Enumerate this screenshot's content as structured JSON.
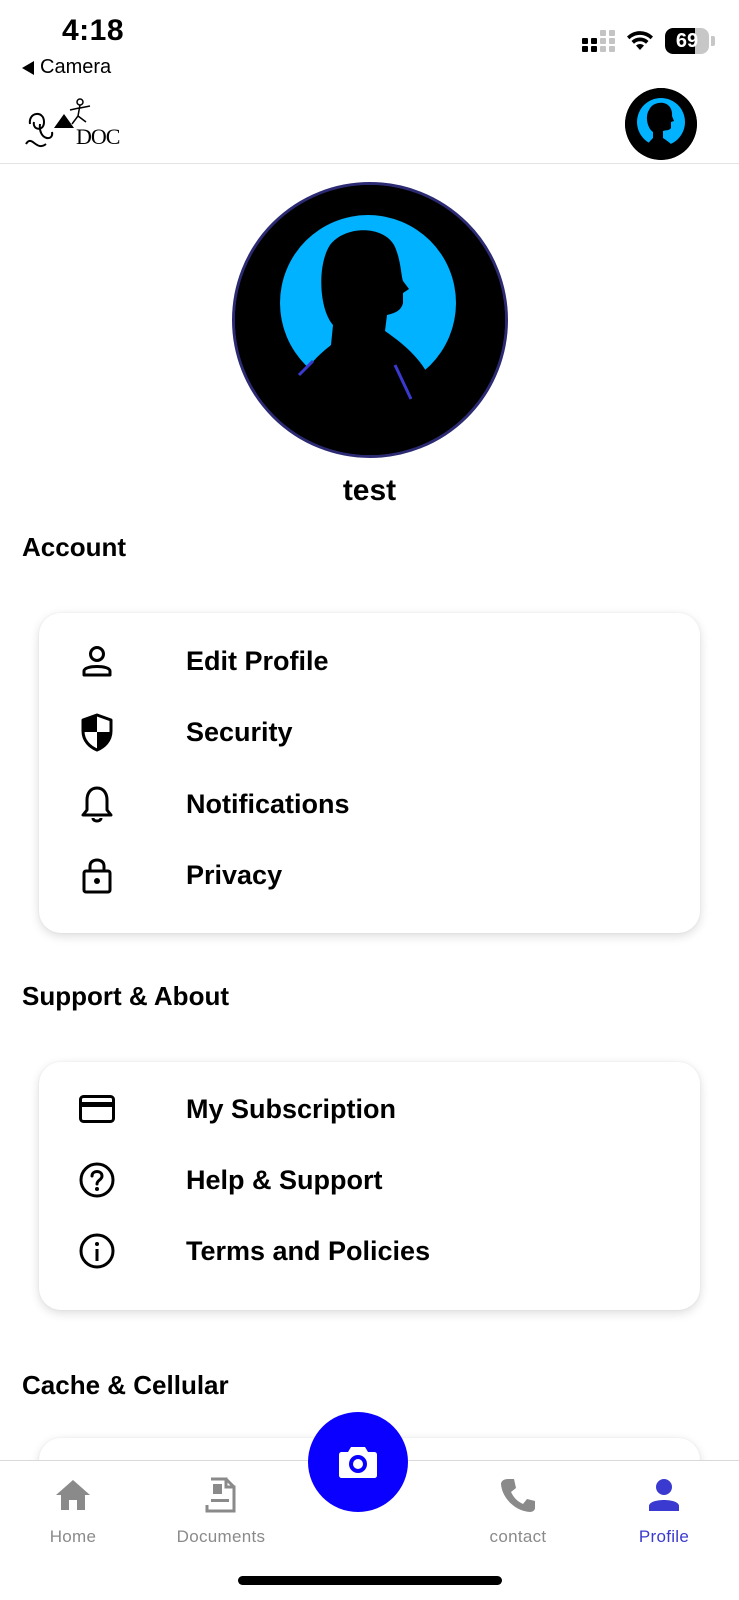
{
  "status_bar": {
    "time": "4:18",
    "back_app": "Camera",
    "battery": "69",
    "battery_level": 0.69
  },
  "header": {
    "logo_text": "DOC"
  },
  "profile": {
    "name": "test"
  },
  "sections": {
    "account": {
      "title": "Account",
      "items": [
        {
          "label": "Edit Profile",
          "icon": "person-outline-icon"
        },
        {
          "label": "Security",
          "icon": "shield-icon"
        },
        {
          "label": "Notifications",
          "icon": "bell-icon"
        },
        {
          "label": "Privacy",
          "icon": "lock-icon"
        }
      ]
    },
    "support": {
      "title": "Support & About",
      "items": [
        {
          "label": "My Subscription",
          "icon": "credit-card-icon"
        },
        {
          "label": "Help & Support",
          "icon": "help-circle-icon"
        },
        {
          "label": "Terms and Policies",
          "icon": "info-circle-icon"
        }
      ]
    },
    "cache": {
      "title": "Cache & Cellular"
    }
  },
  "bottom_nav": {
    "items": [
      {
        "label": "Home",
        "icon": "home-icon"
      },
      {
        "label": "Documents",
        "icon": "document-icon"
      },
      {
        "label": "contact",
        "icon": "phone-icon"
      },
      {
        "label": "Profile",
        "icon": "person-icon"
      }
    ],
    "fab_icon": "camera-icon",
    "active": "Profile"
  },
  "colors": {
    "accent": "#0a00ff",
    "active_tab": "#3a3ad0",
    "inactive_tab": "#8a8a8a",
    "avatar_glow": "#00b2ff"
  }
}
